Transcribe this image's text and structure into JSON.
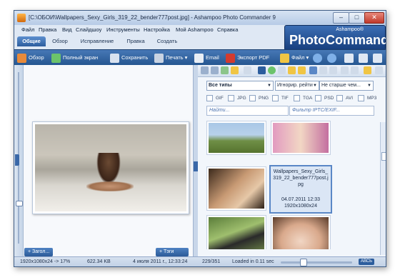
{
  "window": {
    "title": "[C:\\ОБОИ\\Wallpapers_Sexy_Girls_319_22_bender777post.jpg] - Ashampoo Photo Commander 9"
  },
  "menu": [
    "Файл",
    "Правка",
    "Вид",
    "Слайдшоу",
    "Инструменты",
    "Настройка",
    "Мой Ashampoo",
    "Справка"
  ],
  "logo": {
    "sub": "Ashampoo®",
    "main": "PhotoCommander 9"
  },
  "tabs": [
    "Общие",
    "Обзор",
    "Исправление",
    "Правка",
    "Создать"
  ],
  "toolbar": {
    "browse": "Обзор",
    "fullscreen": "Полный экран",
    "save": "Сохранить",
    "print": "Печать ▾",
    "email": "Email",
    "export_pdf": "Экспорт PDF",
    "file": "Файл ▾"
  },
  "left_panel": {
    "headers_btn": "+ Загол...",
    "tags_btn": "+ Тэги"
  },
  "right_panel": {
    "filter_type": "Все типы",
    "filter_rating": "Игнорир. рейти",
    "filter_age": "Не старше чем...",
    "types": [
      "GIF",
      "JPG",
      "PNG",
      "TIF",
      "TGA",
      "PSD",
      "AVI",
      "MP3"
    ],
    "search_placeholder": "Найти...",
    "iptc_filter": "Фильтр IPTC/EXIF...",
    "selected_thumb": {
      "name": "Wallpapers_Sexy_Girls_319_22_bender777post.jpg",
      "date": "04.07.2011 12:33",
      "dims": "1920x1080x24"
    }
  },
  "status": {
    "resolution": "1920x1080x24 -> 17%",
    "filesize": "622.34 KB",
    "date": "4 июля 2011 г., 12:33:24",
    "count": "229/351",
    "loaded": "Loaded in 0.11 sec",
    "caps": "АВСЬ"
  },
  "colors": {
    "toolbar": "#2c5d9d",
    "accent": "#3a68a8",
    "window_bg": "#dfe8f4"
  }
}
